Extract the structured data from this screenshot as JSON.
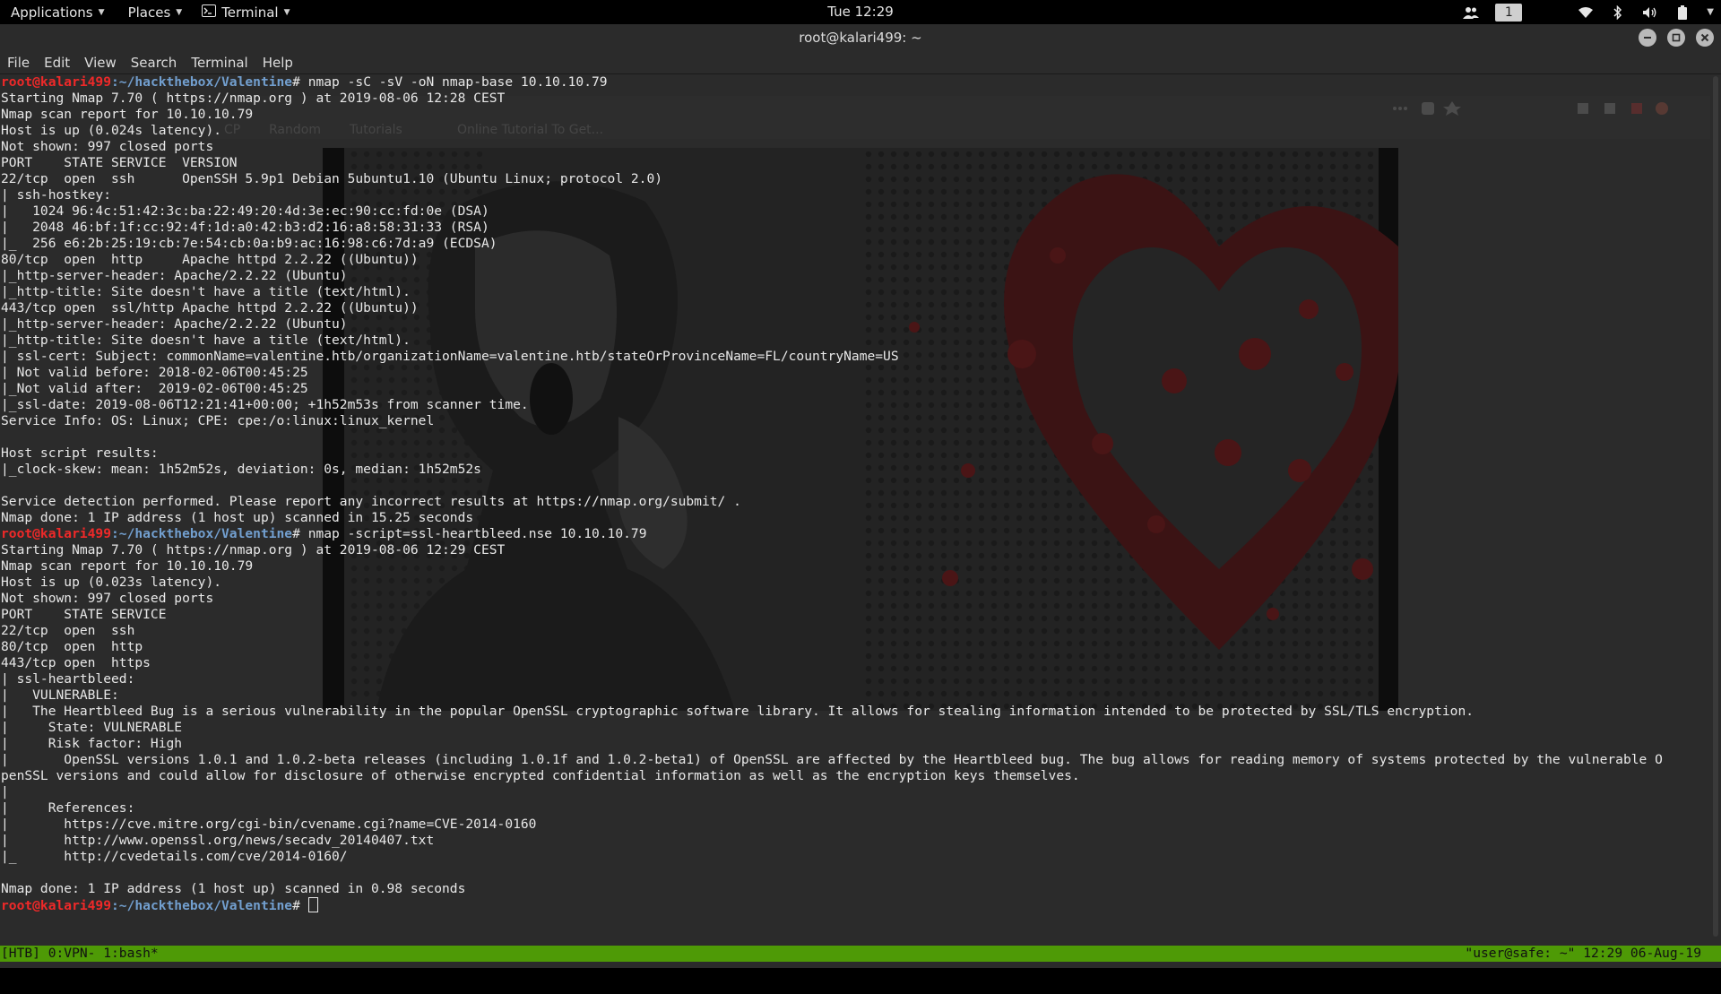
{
  "topbar": {
    "applications": "Applications",
    "places": "Places",
    "terminal": "Terminal",
    "clock": "Tue 12:29",
    "workspace": "1",
    "icons": [
      "users-icon",
      "wifi-icon",
      "bluetooth-icon",
      "volume-icon",
      "battery-icon"
    ]
  },
  "window": {
    "title": "root@kalari499: ~",
    "controls": [
      "minimize-icon",
      "maximize-icon",
      "close-icon"
    ]
  },
  "menubar": [
    "File",
    "Edit",
    "View",
    "Search",
    "Terminal",
    "Help"
  ],
  "background_ghost": {
    "bookmarks": [
      "CP",
      "Random",
      "Tutorials",
      "Online Tutorial To Get..."
    ]
  },
  "prompt": {
    "user": "root@kalari499",
    "path": ":~/hackthebox/Valentine",
    "symbol": "# "
  },
  "terminal_lines": [
    {
      "type": "cmd",
      "text": "nmap -sC -sV -oN nmap-base 10.10.10.79"
    },
    {
      "type": "out",
      "text": "Starting Nmap 7.70 ( https://nmap.org ) at 2019-08-06 12:28 CEST"
    },
    {
      "type": "out",
      "text": "Nmap scan report for 10.10.10.79"
    },
    {
      "type": "out",
      "text": "Host is up (0.024s latency)."
    },
    {
      "type": "out",
      "text": "Not shown: 997 closed ports"
    },
    {
      "type": "out",
      "text": "PORT    STATE SERVICE  VERSION"
    },
    {
      "type": "out",
      "text": "22/tcp  open  ssh      OpenSSH 5.9p1 Debian 5ubuntu1.10 (Ubuntu Linux; protocol 2.0)"
    },
    {
      "type": "out",
      "text": "| ssh-hostkey: "
    },
    {
      "type": "out",
      "text": "|   1024 96:4c:51:42:3c:ba:22:49:20:4d:3e:ec:90:cc:fd:0e (DSA)"
    },
    {
      "type": "out",
      "text": "|   2048 46:bf:1f:cc:92:4f:1d:a0:42:b3:d2:16:a8:58:31:33 (RSA)"
    },
    {
      "type": "out",
      "text": "|_  256 e6:2b:25:19:cb:7e:54:cb:0a:b9:ac:16:98:c6:7d:a9 (ECDSA)"
    },
    {
      "type": "out",
      "text": "80/tcp  open  http     Apache httpd 2.2.22 ((Ubuntu))"
    },
    {
      "type": "out",
      "text": "|_http-server-header: Apache/2.2.22 (Ubuntu)"
    },
    {
      "type": "out",
      "text": "|_http-title: Site doesn't have a title (text/html)."
    },
    {
      "type": "out",
      "text": "443/tcp open  ssl/http Apache httpd 2.2.22 ((Ubuntu))"
    },
    {
      "type": "out",
      "text": "|_http-server-header: Apache/2.2.22 (Ubuntu)"
    },
    {
      "type": "out",
      "text": "|_http-title: Site doesn't have a title (text/html)."
    },
    {
      "type": "out",
      "text": "| ssl-cert: Subject: commonName=valentine.htb/organizationName=valentine.htb/stateOrProvinceName=FL/countryName=US"
    },
    {
      "type": "out",
      "text": "| Not valid before: 2018-02-06T00:45:25"
    },
    {
      "type": "out",
      "text": "|_Not valid after:  2019-02-06T00:45:25"
    },
    {
      "type": "out",
      "text": "|_ssl-date: 2019-08-06T12:21:41+00:00; +1h52m53s from scanner time."
    },
    {
      "type": "out",
      "text": "Service Info: OS: Linux; CPE: cpe:/o:linux:linux_kernel"
    },
    {
      "type": "out",
      "text": ""
    },
    {
      "type": "out",
      "text": "Host script results:"
    },
    {
      "type": "out",
      "text": "|_clock-skew: mean: 1h52m52s, deviation: 0s, median: 1h52m52s"
    },
    {
      "type": "out",
      "text": ""
    },
    {
      "type": "out",
      "text": "Service detection performed. Please report any incorrect results at https://nmap.org/submit/ ."
    },
    {
      "type": "out",
      "text": "Nmap done: 1 IP address (1 host up) scanned in 15.25 seconds"
    },
    {
      "type": "cmd",
      "text": "nmap -script=ssl-heartbleed.nse 10.10.10.79"
    },
    {
      "type": "out",
      "text": "Starting Nmap 7.70 ( https://nmap.org ) at 2019-08-06 12:29 CEST"
    },
    {
      "type": "out",
      "text": "Nmap scan report for 10.10.10.79"
    },
    {
      "type": "out",
      "text": "Host is up (0.023s latency)."
    },
    {
      "type": "out",
      "text": "Not shown: 997 closed ports"
    },
    {
      "type": "out",
      "text": "PORT    STATE SERVICE"
    },
    {
      "type": "out",
      "text": "22/tcp  open  ssh"
    },
    {
      "type": "out",
      "text": "80/tcp  open  http"
    },
    {
      "type": "out",
      "text": "443/tcp open  https"
    },
    {
      "type": "out",
      "text": "| ssl-heartbleed: "
    },
    {
      "type": "out",
      "text": "|   VULNERABLE:"
    },
    {
      "type": "out",
      "text": "|   The Heartbleed Bug is a serious vulnerability in the popular OpenSSL cryptographic software library. It allows for stealing information intended to be protected by SSL/TLS encryption."
    },
    {
      "type": "out",
      "text": "|     State: VULNERABLE"
    },
    {
      "type": "out",
      "text": "|     Risk factor: High"
    },
    {
      "type": "out",
      "text": "|       OpenSSL versions 1.0.1 and 1.0.2-beta releases (including 1.0.1f and 1.0.2-beta1) of OpenSSL are affected by the Heartbleed bug. The bug allows for reading memory of systems protected by the vulnerable O"
    },
    {
      "type": "out",
      "text": "penSSL versions and could allow for disclosure of otherwise encrypted confidential information as well as the encryption keys themselves."
    },
    {
      "type": "out",
      "text": "|           "
    },
    {
      "type": "out",
      "text": "|     References:"
    },
    {
      "type": "out",
      "text": "|       https://cve.mitre.org/cgi-bin/cvename.cgi?name=CVE-2014-0160"
    },
    {
      "type": "out",
      "text": "|       http://www.openssl.org/news/secadv_20140407.txt "
    },
    {
      "type": "out",
      "text": "|_      http://cvedetails.com/cve/2014-0160/"
    },
    {
      "type": "out",
      "text": ""
    },
    {
      "type": "out",
      "text": "Nmap done: 1 IP address (1 host up) scanned in 0.98 seconds"
    },
    {
      "type": "cmd",
      "text": "",
      "cursor": true
    }
  ],
  "tmux": {
    "left": "[HTB] 0:VPN- 1:bash*",
    "right": "\"user@safe: ~\" 12:29 06-Aug-19"
  }
}
